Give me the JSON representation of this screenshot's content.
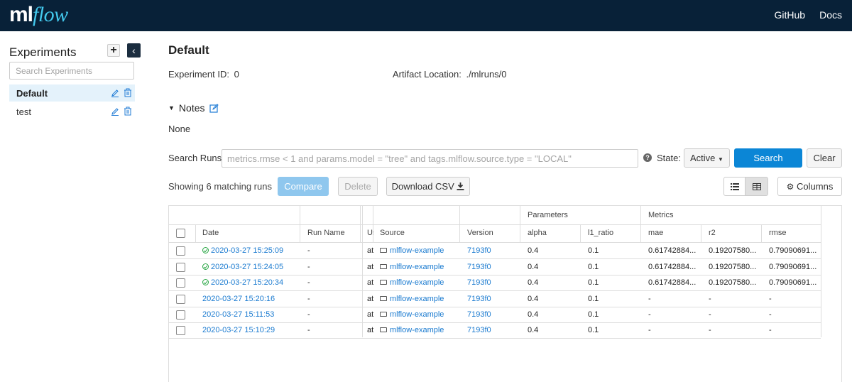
{
  "header": {
    "logo_ml": "ml",
    "logo_flow": "flow",
    "links": [
      "GitHub",
      "Docs"
    ]
  },
  "sidebar": {
    "title": "Experiments",
    "add_label": "+",
    "collapse_label": "‹",
    "search_placeholder": "Search Experiments",
    "items": [
      {
        "label": "Default",
        "active": true
      },
      {
        "label": "test",
        "active": false
      }
    ]
  },
  "experiment": {
    "title": "Default",
    "id_label": "Experiment ID:",
    "id_value": "0",
    "artifact_label": "Artifact Location:",
    "artifact_value": "./mlruns/0",
    "notes_label": "Notes",
    "notes_value": "None"
  },
  "search": {
    "label": "Search Runs:",
    "placeholder": "metrics.rmse < 1 and params.model = \"tree\" and tags.mlflow.source.type = \"LOCAL\"",
    "state_label": "State:",
    "state_value": "Active",
    "search_button": "Search",
    "clear_button": "Clear"
  },
  "actions": {
    "showing": "Showing 6 matching runs",
    "compare": "Compare",
    "delete": "Delete",
    "download": "Download CSV",
    "columns": "Columns"
  },
  "table": {
    "group_headers": {
      "parameters": "Parameters",
      "metrics": "Metrics"
    },
    "columns": [
      "Date",
      "Run Name",
      "Us",
      "Source",
      "Version",
      "alpha",
      "l1_ratio",
      "mae",
      "r2",
      "rmse"
    ],
    "rows": [
      {
        "date": "2020-03-27 15:25:09",
        "ok": true,
        "run_name": "-",
        "user": "at",
        "source": "mlflow-example",
        "version": "7193f0",
        "alpha": "0.4",
        "l1_ratio": "0.1",
        "mae": "0.61742884...",
        "r2": "0.19207580...",
        "rmse": "0.79090691..."
      },
      {
        "date": "2020-03-27 15:24:05",
        "ok": true,
        "run_name": "-",
        "user": "at",
        "source": "mlflow-example",
        "version": "7193f0",
        "alpha": "0.4",
        "l1_ratio": "0.1",
        "mae": "0.61742884...",
        "r2": "0.19207580...",
        "rmse": "0.79090691..."
      },
      {
        "date": "2020-03-27 15:20:34",
        "ok": true,
        "run_name": "-",
        "user": "at",
        "source": "mlflow-example",
        "version": "7193f0",
        "alpha": "0.4",
        "l1_ratio": "0.1",
        "mae": "0.61742884...",
        "r2": "0.19207580...",
        "rmse": "0.79090691..."
      },
      {
        "date": "2020-03-27 15:20:16",
        "ok": false,
        "run_name": "-",
        "user": "at",
        "source": "mlflow-example",
        "version": "7193f0",
        "alpha": "0.4",
        "l1_ratio": "0.1",
        "mae": "-",
        "r2": "-",
        "rmse": "-"
      },
      {
        "date": "2020-03-27 15:11:53",
        "ok": false,
        "run_name": "-",
        "user": "at",
        "source": "mlflow-example",
        "version": "7193f0",
        "alpha": "0.4",
        "l1_ratio": "0.1",
        "mae": "-",
        "r2": "-",
        "rmse": "-"
      },
      {
        "date": "2020-03-27 15:10:29",
        "ok": false,
        "run_name": "-",
        "user": "at",
        "source": "mlflow-example",
        "version": "7193f0",
        "alpha": "0.4",
        "l1_ratio": "0.1",
        "mae": "-",
        "r2": "-",
        "rmse": "-"
      }
    ]
  },
  "colors": {
    "header_bg": "#082138",
    "logo_accent": "#43c9ed",
    "primary": "#0b86d6",
    "link": "#1b7bd0",
    "success": "#2aa745",
    "selected_bg": "#e4f2fb"
  }
}
